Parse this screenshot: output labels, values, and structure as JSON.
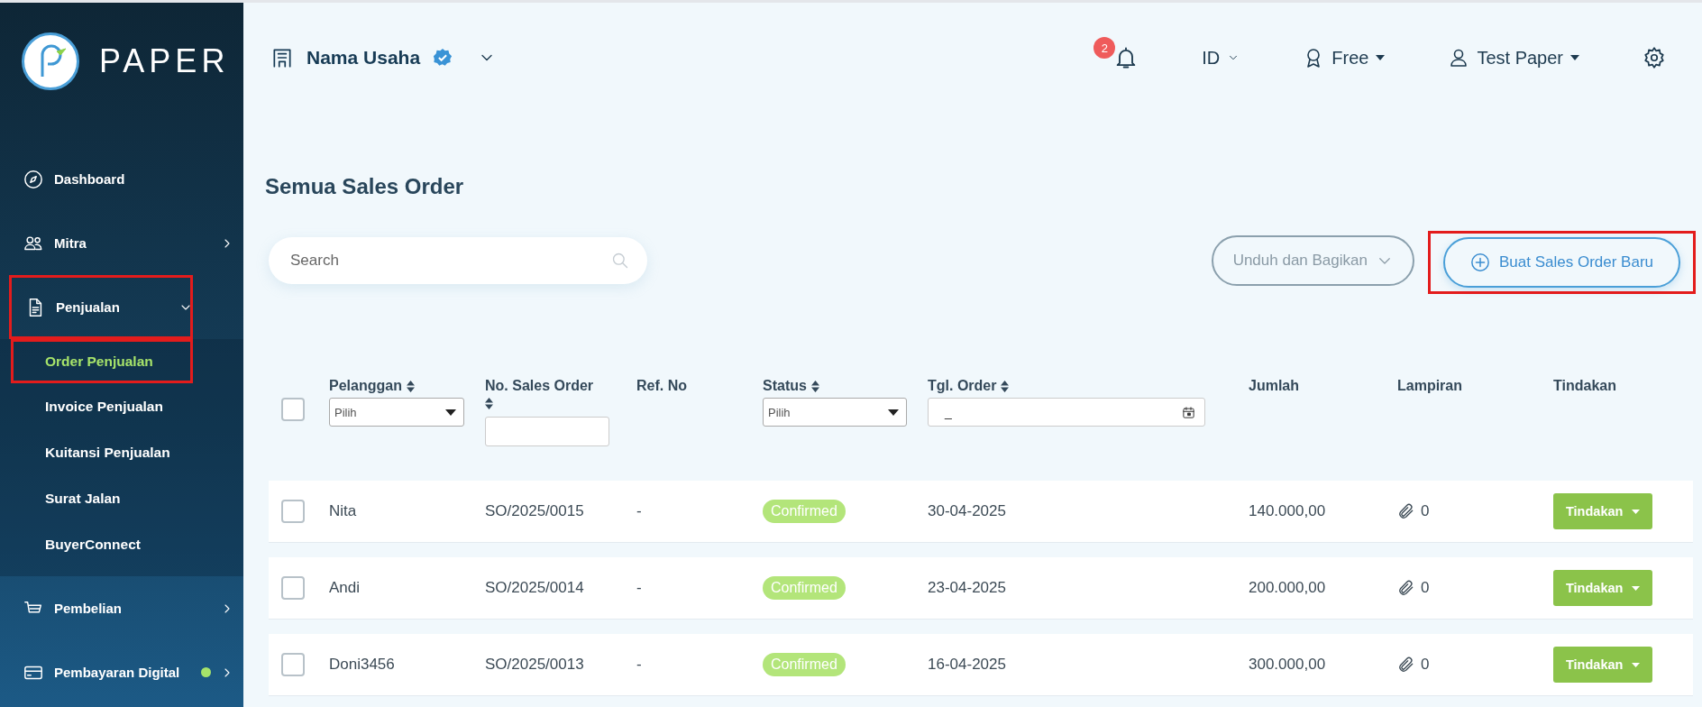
{
  "sidebar": {
    "logo": "PAPER",
    "items": [
      {
        "label": "Dashboard",
        "expandable": false,
        "highlighted": false,
        "new": false
      },
      {
        "label": "Mitra",
        "expandable": true,
        "expanded": false,
        "highlighted": false,
        "new": false
      },
      {
        "label": "Penjualan",
        "expandable": true,
        "expanded": true,
        "highlighted": true,
        "new": false,
        "children": [
          {
            "label": "Order Penjualan",
            "selected": true,
            "highlighted": true
          },
          {
            "label": "Invoice Penjualan",
            "selected": false,
            "highlighted": false
          },
          {
            "label": "Kuitansi Penjualan",
            "selected": false,
            "highlighted": false
          },
          {
            "label": "Surat Jalan",
            "selected": false,
            "highlighted": false
          },
          {
            "label": "BuyerConnect",
            "selected": false,
            "highlighted": false
          }
        ]
      },
      {
        "label": "Pembelian",
        "expandable": true,
        "expanded": false,
        "highlighted": false,
        "new": false
      },
      {
        "label": "Pembayaran Digital",
        "expandable": true,
        "expanded": false,
        "highlighted": false,
        "new": true
      }
    ]
  },
  "header": {
    "business": "Nama Usaha",
    "verified": true,
    "notifications": "2",
    "language": "ID",
    "plan": "Free",
    "user": "Test Paper"
  },
  "page_title": "Semua Sales Order",
  "search": {
    "placeholder": "Search"
  },
  "buttons": [
    {
      "label": "Unduh dan Bagikan",
      "kind": "dropdown",
      "highlighted": false
    },
    {
      "label": "Buat Sales Order Baru",
      "kind": "add",
      "highlighted": true
    }
  ],
  "table": {
    "select_all": {
      "checked": false
    },
    "columns": [
      {
        "label": "Pelanggan",
        "sortable": true,
        "filter": {
          "kind": "select",
          "placeholder": "Pilih"
        }
      },
      {
        "label": "No. Sales Order",
        "sortable": true,
        "filter": {
          "kind": "text"
        }
      },
      {
        "label": "Ref. No",
        "sortable": false
      },
      {
        "label": "Status",
        "sortable": true,
        "filter": {
          "kind": "select",
          "placeholder": "Pilih"
        }
      },
      {
        "label": "Tgl. Order",
        "sortable": true,
        "filter": {
          "kind": "date",
          "value": "_"
        }
      },
      {
        "label": "Jumlah",
        "sortable": false
      },
      {
        "label": "Lampiran",
        "sortable": false
      },
      {
        "label": "Tindakan",
        "sortable": false
      }
    ],
    "rows": [
      {
        "checked": false,
        "pelanggan": "Nita",
        "no": "SO/2025/0015",
        "ref": "-",
        "status": "Confirmed",
        "tanggal": "30-04-2025",
        "jumlah": "140.000,00",
        "lampiran": "0",
        "tindakan": "Tindakan"
      },
      {
        "checked": false,
        "pelanggan": "Andi",
        "no": "SO/2025/0014",
        "ref": "-",
        "status": "Confirmed",
        "tanggal": "23-04-2025",
        "jumlah": "200.000,00",
        "lampiran": "0",
        "tindakan": "Tindakan"
      },
      {
        "checked": false,
        "pelanggan": "Doni3456",
        "no": "SO/2025/0013",
        "ref": "-",
        "status": "Confirmed",
        "tanggal": "16-04-2025",
        "jumlah": "300.000,00",
        "lampiran": "0",
        "tindakan": "Tindakan"
      }
    ]
  }
}
